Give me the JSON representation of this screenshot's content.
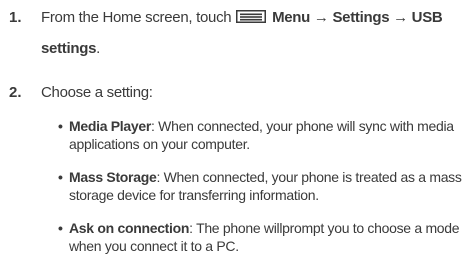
{
  "steps": [
    {
      "number": "1.",
      "prefix": "From the Home screen, touch ",
      "icon": "menu-icon",
      "path_first": "Menu → Settings → USB",
      "path_second": "settings",
      "suffix": "."
    },
    {
      "number": "2.",
      "text": "Choose a setting:"
    }
  ],
  "options": [
    {
      "term": "Media Player",
      "desc": ": When connected, your phone will sync with media applications on your computer."
    },
    {
      "term": "Mass Storage",
      "desc": ": When connected, your phone is treated as a mass storage device for transferring information."
    },
    {
      "term": "Ask on connection",
      "desc": ": The phone willprompt you to choose a mode when you connect it to a PC."
    }
  ],
  "colors": {
    "text": "#3a3a3a",
    "icon": "#3a3a3a"
  }
}
